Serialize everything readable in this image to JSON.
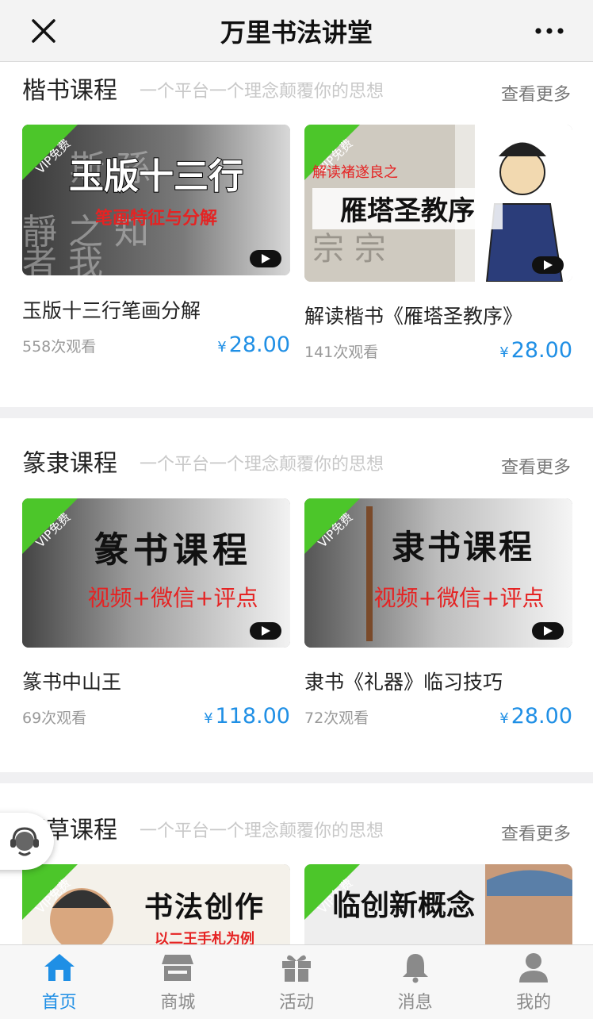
{
  "header": {
    "title": "万里书法讲堂"
  },
  "colors": {
    "accent": "#1f8fe5",
    "vip_badge": "#4cc62a"
  },
  "sections": [
    {
      "title": "楷书课程",
      "slogan": "一个平台一个理念颠覆你的思想",
      "more": "查看更多",
      "cards": [
        {
          "badge": "VIP免费",
          "banner_main": "玉版十三行",
          "banner_sub": "笔画特征与分解",
          "title": "玉版十三行笔画分解",
          "views": "558次观看",
          "currency": "¥",
          "price": "28.00"
        },
        {
          "badge": "VIP免费",
          "banner_top": "解读褚遂良之",
          "banner_main": "雁塔圣教序",
          "title": "解读楷书《雁塔圣教序》",
          "views": "141次观看",
          "currency": "¥",
          "price": "28.00"
        }
      ]
    },
    {
      "title": "篆隶课程",
      "slogan": "一个平台一个理念颠覆你的思想",
      "more": "查看更多",
      "cards": [
        {
          "badge": "VIP免费",
          "banner_main": "篆书课程",
          "banner_sub": "视频+微信+评点",
          "title": "篆书中山王",
          "views": "69次观看",
          "currency": "¥",
          "price": "118.00"
        },
        {
          "badge": "VIP免费",
          "banner_main": "隶书课程",
          "banner_sub": "视频+微信+评点",
          "title": "隶书《礼器》临习技巧",
          "views": "72次观看",
          "currency": "¥",
          "price": "28.00"
        }
      ]
    },
    {
      "title": "行草课程",
      "slogan": "一个平台一个理念颠覆你的思想",
      "more": "查看更多",
      "cards": [
        {
          "badge": "VIP免费",
          "banner_main": "书法创作",
          "banner_sub": "以二王手札为例"
        },
        {
          "badge": "VIP免费",
          "banner_main": "临创新概念"
        }
      ]
    }
  ],
  "tabs": [
    {
      "label": "首页",
      "icon": "home-icon",
      "active": true
    },
    {
      "label": "商城",
      "icon": "shop-icon",
      "active": false
    },
    {
      "label": "活动",
      "icon": "gift-icon",
      "active": false
    },
    {
      "label": "消息",
      "icon": "bell-icon",
      "active": false
    },
    {
      "label": "我的",
      "icon": "user-icon",
      "active": false
    }
  ]
}
